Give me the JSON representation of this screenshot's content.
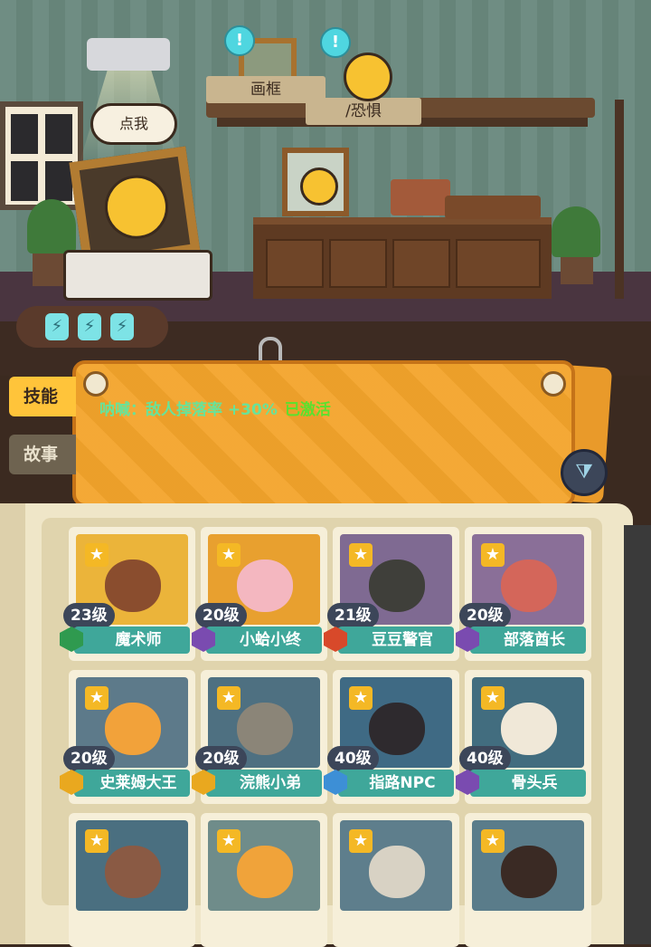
{
  "room": {
    "frame_tag": "画框",
    "emotion_tag": "/恐惧",
    "click_me": "点我",
    "alert_symbol": "!",
    "energy_symbol": "⚡"
  },
  "tabs": {
    "skill": "技能",
    "story": "故事"
  },
  "skill": {
    "effect": "呐喊：敌人掉落率 +30%",
    "status": "已激活"
  },
  "filter_icon": "⧩",
  "colors": {
    "board": "#f3a42b",
    "skill_text": "#67e39a",
    "active": "#5ae12e",
    "namebar": "#3fa79a",
    "level_badge": "#3c4659"
  },
  "cards": [
    {
      "level": "23级",
      "name": "魔术师",
      "rank_color": "#2f9a4f",
      "bg": "#ebb43a",
      "face": "#8a4d2e",
      "icon": "top-hat"
    },
    {
      "level": "20级",
      "name": "小蛤小终",
      "rank_color": "#7a4bb0",
      "bg": "#e8a02f",
      "face": "#f4b7c0",
      "icon": "flower-crown"
    },
    {
      "level": "21级",
      "name": "豆豆警官",
      "rank_color": "#d8492a",
      "bg": "#7f6a92",
      "face": "#3f3f3a",
      "icon": "police-helmet"
    },
    {
      "level": "20级",
      "name": "部落酋长",
      "rank_color": "#7a4bb0",
      "bg": "#8a6f98",
      "face": "#d4665a",
      "icon": "feather-headdress"
    },
    {
      "level": "20级",
      "name": "史莱姆大王",
      "rank_color": "#e9a81f",
      "bg": "#5d7a8a",
      "face": "#f2a23a",
      "icon": "crown"
    },
    {
      "level": "20级",
      "name": "浣熊小弟",
      "rank_color": "#e9a81f",
      "bg": "#4e7081",
      "face": "#8b8578",
      "icon": "raccoon"
    },
    {
      "level": "40级",
      "name": "指路NPC",
      "rank_color": "#3d8fd6",
      "bg": "#3f6a84",
      "face": "#2e2a2e",
      "icon": "black-cat"
    },
    {
      "level": "40级",
      "name": "骨头兵",
      "rank_color": "#7a4bb0",
      "bg": "#426d7f",
      "face": "#f0e8d8",
      "icon": "skeleton"
    },
    {
      "level": "",
      "name": "",
      "rank_color": "#7a4bb0",
      "bg": "#4a6f80",
      "face": "#8a5a44",
      "icon": "cat-ears"
    },
    {
      "level": "",
      "name": "",
      "rank_color": "#7a4bb0",
      "bg": "#6f8c8a",
      "face": "#f0a33a",
      "icon": "fox"
    },
    {
      "level": "",
      "name": "",
      "rank_color": "#7a4bb0",
      "bg": "#5e7e8c",
      "face": "#d8d2c4",
      "icon": "old-man"
    },
    {
      "level": "",
      "name": "",
      "rank_color": "#7a4bb0",
      "bg": "#5a7c8a",
      "face": "#3a2a24",
      "icon": "glasses-girl"
    }
  ]
}
